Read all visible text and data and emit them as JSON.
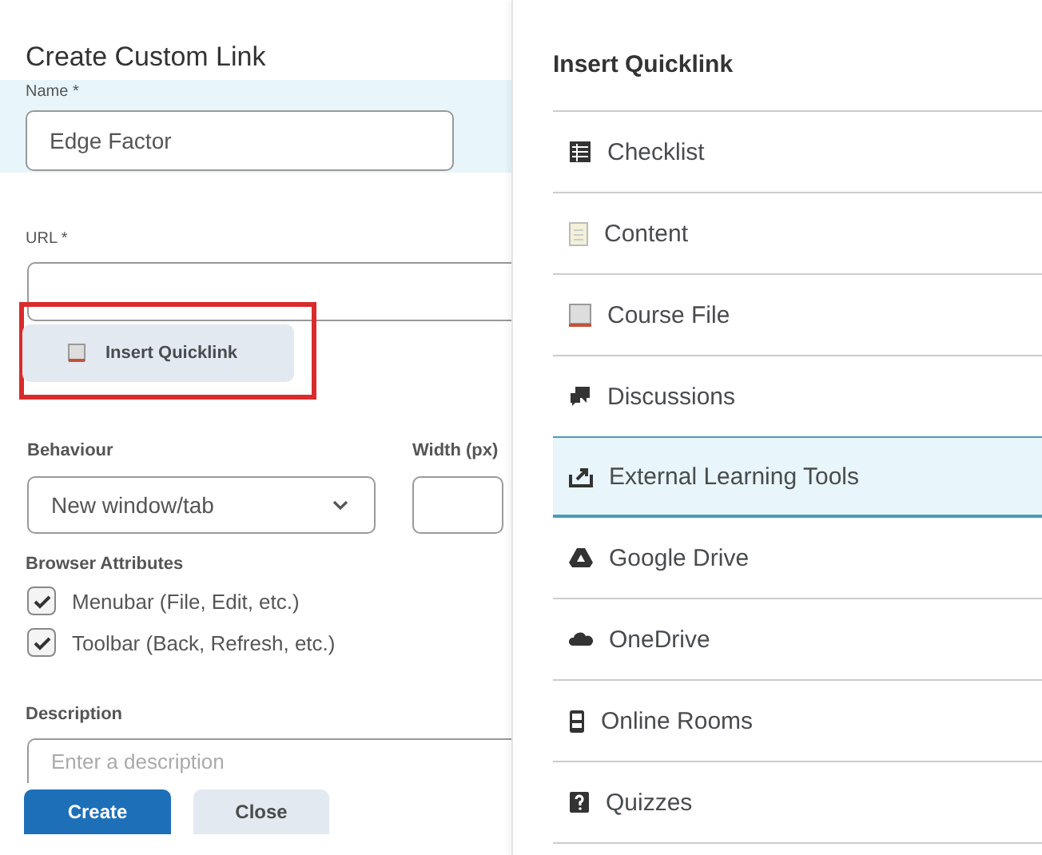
{
  "form": {
    "title": "Create Custom Link",
    "name_field": {
      "label": "Name *",
      "value": "Edge Factor",
      "highlighted": true
    },
    "url_field": {
      "label": "URL *"
    },
    "quicklink_button": {
      "label": "Insert Quicklink",
      "highlighted": true
    },
    "behaviour": {
      "label": "Behaviour",
      "value": "New window/tab"
    },
    "width": {
      "label": "Width (px)"
    },
    "browser_attributes": {
      "label": "Browser Attributes",
      "options": [
        {
          "label": "Menubar (File, Edit, etc.)",
          "checked": true
        },
        {
          "label": "Toolbar (Back, Refresh, etc.)",
          "checked": true
        }
      ]
    },
    "description": {
      "label": "Description",
      "placeholder": "Enter a description"
    },
    "buttons": [
      {
        "label": "Create",
        "kind": "primary"
      },
      {
        "label": "Close",
        "kind": "secondary"
      }
    ]
  },
  "quicklink_panel": {
    "title": "Insert Quicklink",
    "items": [
      {
        "label": "Checklist",
        "kind": "checklist",
        "selected": false
      },
      {
        "label": "Content",
        "kind": "content",
        "selected": false
      },
      {
        "label": "Course File",
        "kind": "file",
        "selected": false
      },
      {
        "label": "Discussions",
        "kind": "discussions",
        "selected": false
      },
      {
        "label": "External Learning Tools",
        "kind": "external",
        "selected": true
      },
      {
        "label": "Google Drive",
        "kind": "drive",
        "selected": false
      },
      {
        "label": "OneDrive",
        "kind": "cloud",
        "selected": false
      },
      {
        "label": "Online Rooms",
        "kind": "rooms",
        "selected": false
      },
      {
        "label": "Quizzes",
        "kind": "quiz",
        "selected": false
      }
    ]
  }
}
